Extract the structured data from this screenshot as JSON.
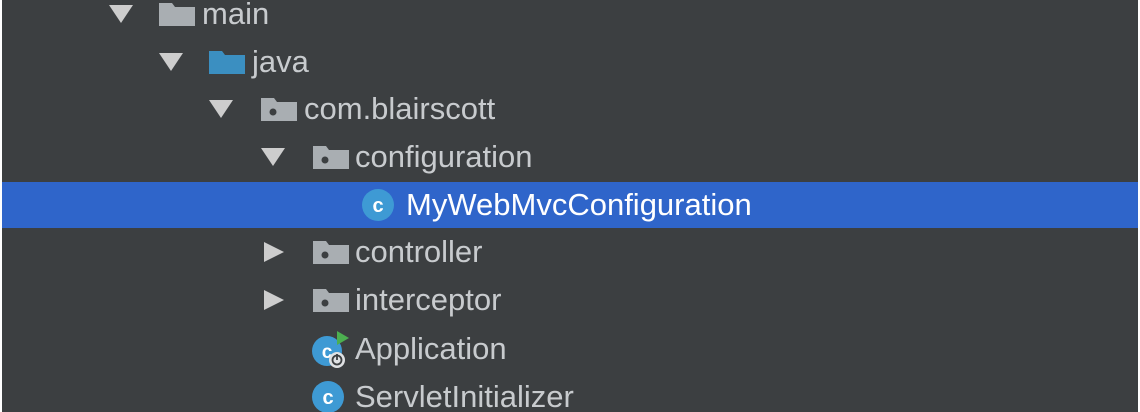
{
  "project_tree": {
    "items": [
      {
        "label": "main",
        "icon": "folder-icon",
        "expanded": true
      },
      {
        "label": "java",
        "icon": "source-folder-icon",
        "expanded": true
      },
      {
        "label": "com.blairscott",
        "icon": "package-icon",
        "expanded": true
      },
      {
        "label": "configuration",
        "icon": "package-icon",
        "expanded": true
      },
      {
        "label": "MyWebMvcConfiguration",
        "icon": "class-icon",
        "selected": true
      },
      {
        "label": "controller",
        "icon": "package-icon",
        "expanded": false
      },
      {
        "label": "interceptor",
        "icon": "package-icon",
        "expanded": false
      },
      {
        "label": "Application",
        "icon": "spring-boot-application-icon"
      },
      {
        "label": "ServletInitializer",
        "icon": "class-icon"
      }
    ]
  },
  "colors": {
    "background": "#3c3f41",
    "selection": "#2f65ca",
    "text": "#c8cbce",
    "selected_text": "#ffffff",
    "source_folder": "#3b8fc1",
    "class_icon": "#3e9ad4",
    "run_badge": "#4caf50"
  }
}
